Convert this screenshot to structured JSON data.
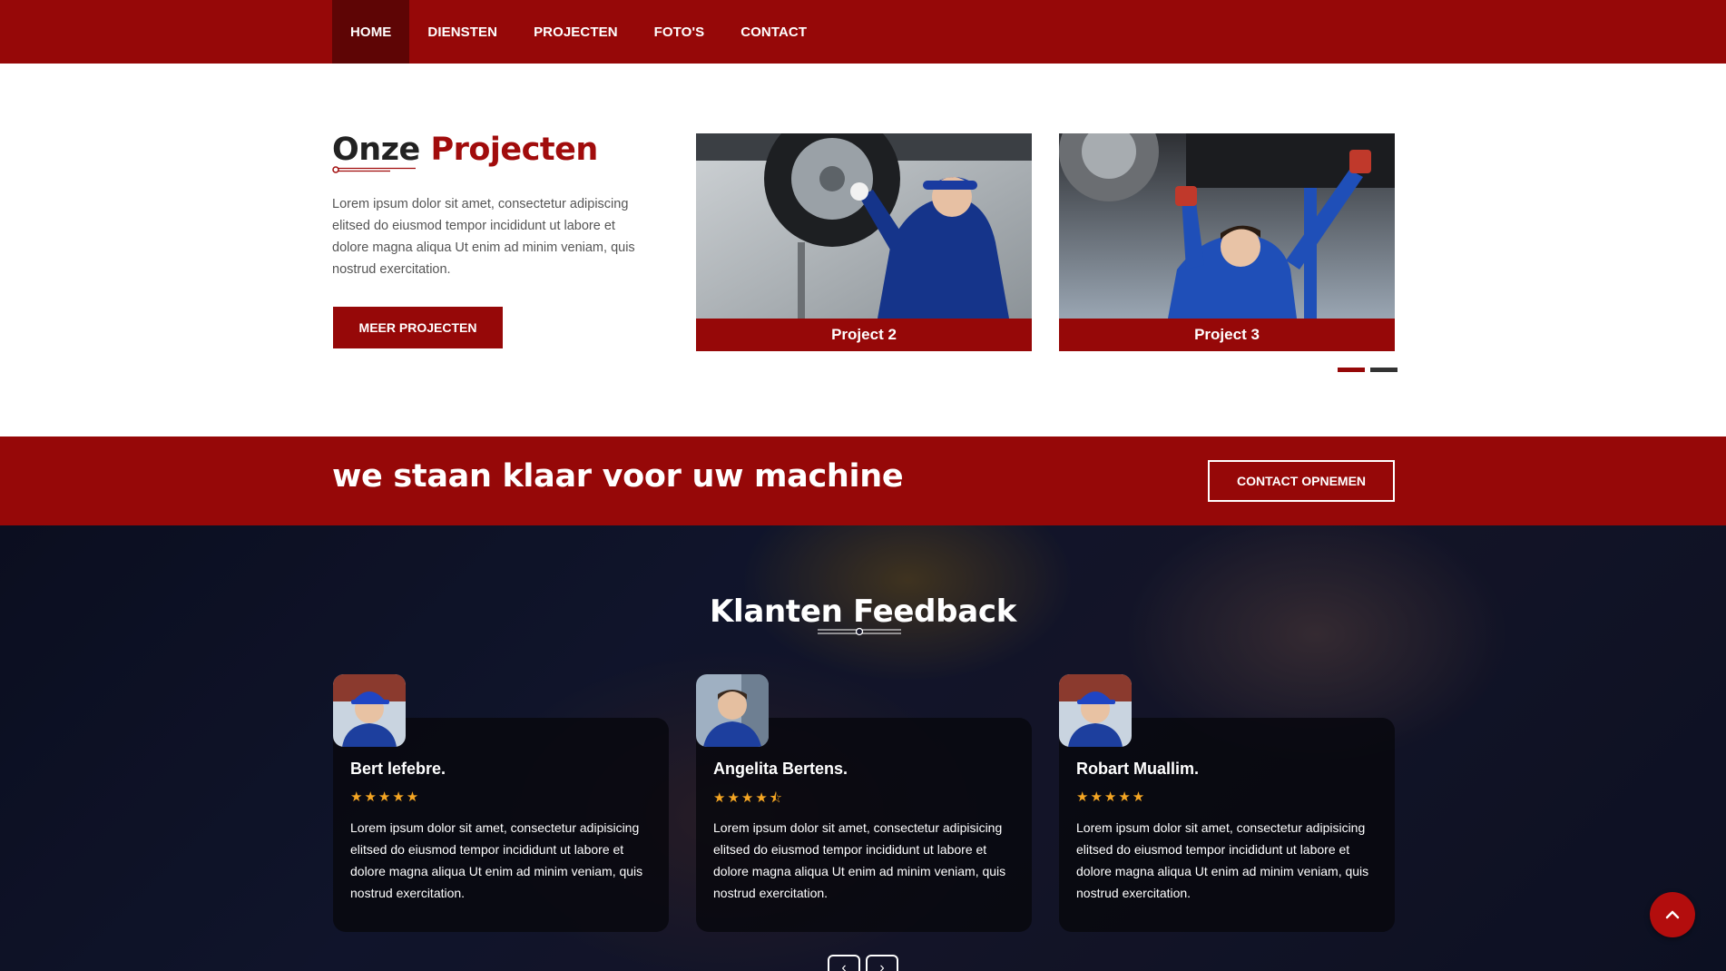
{
  "nav": {
    "items": [
      {
        "label": "HOME"
      },
      {
        "label": "DIENSTEN"
      },
      {
        "label": "PROJECTEN"
      },
      {
        "label": "FOTO'S"
      },
      {
        "label": "CONTACT"
      }
    ]
  },
  "projects": {
    "title_part1": "Onze",
    "title_part2": "Projecten",
    "text": "Lorem ipsum dolor sit amet, consectetur adipiscing elitsed do eiusmod tempor incididunt ut labore et dolore magna aliqua Ut enim ad minim veniam, quis nostrud exercitation.",
    "button_label": "MEER PROJECTEN",
    "cards": [
      {
        "caption": "Project 2"
      },
      {
        "caption": "Project 3"
      }
    ]
  },
  "cta": {
    "heading": "we staan klaar voor uw machine",
    "button_label": "CONTACT OPNEMEN"
  },
  "feedback": {
    "title": "Klanten Feedback",
    "reviews": [
      {
        "name": "Bert lefebre.",
        "stars": "★★★★★",
        "rating": 5,
        "text": "Lorem ipsum dolor sit amet, consectetur adipisicing elitsed do eiusmod tempor incididunt ut labore et dolore magna aliqua Ut enim ad minim veniam, quis nostrud exercitation."
      },
      {
        "name": "Angelita Bertens.",
        "stars": "★★★★⯪",
        "rating": 4.5,
        "text": "Lorem ipsum dolor sit amet, consectetur adipisicing elitsed do eiusmod tempor incididunt ut labore et dolore magna aliqua Ut enim ad minim veniam, quis nostrud exercitation."
      },
      {
        "name": "Robart Muallim.",
        "stars": "★★★★★",
        "rating": 5,
        "text": "Lorem ipsum dolor sit amet, consectetur adipisicing elitsed do eiusmod tempor incididunt ut labore et dolore magna aliqua Ut enim ad minim veniam, quis nostrud exercitation."
      }
    ],
    "prev_icon": "‹",
    "next_icon": "›"
  },
  "colors": {
    "brand": "#960808",
    "star": "#f5a623"
  }
}
